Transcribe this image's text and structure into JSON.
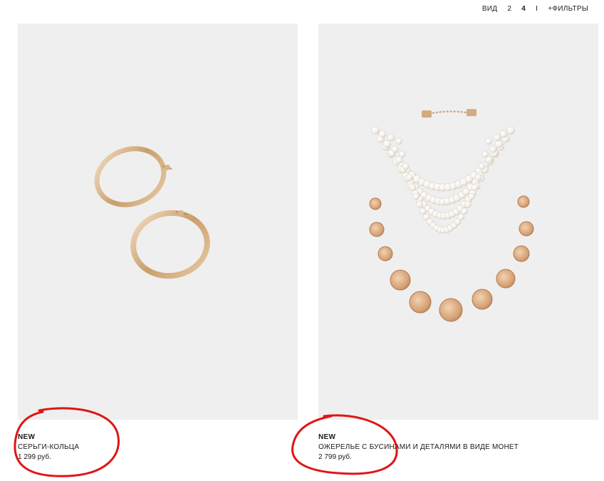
{
  "view_bar": {
    "label": "ВИД",
    "options": [
      "2",
      "4",
      "I"
    ],
    "active": "4",
    "filters_label": "+ФИЛЬТРЫ"
  },
  "products": [
    {
      "badge": "NEW",
      "name": "СЕРЬГИ-КОЛЬЦА",
      "price": "1 299 руб.",
      "image_icon": "hoop-earrings-image"
    },
    {
      "badge": "NEW",
      "name": "ОЖЕРЕЛЬЕ С БУСИНАМИ И ДЕТАЛЯМИ В ВИДЕ МОНЕТ",
      "price": "2 799 руб.",
      "image_icon": "pearl-coin-necklace-image"
    }
  ],
  "colors": {
    "annotation": "#e01515",
    "image_bg": "#efefef",
    "gold": "#d7b58a"
  }
}
